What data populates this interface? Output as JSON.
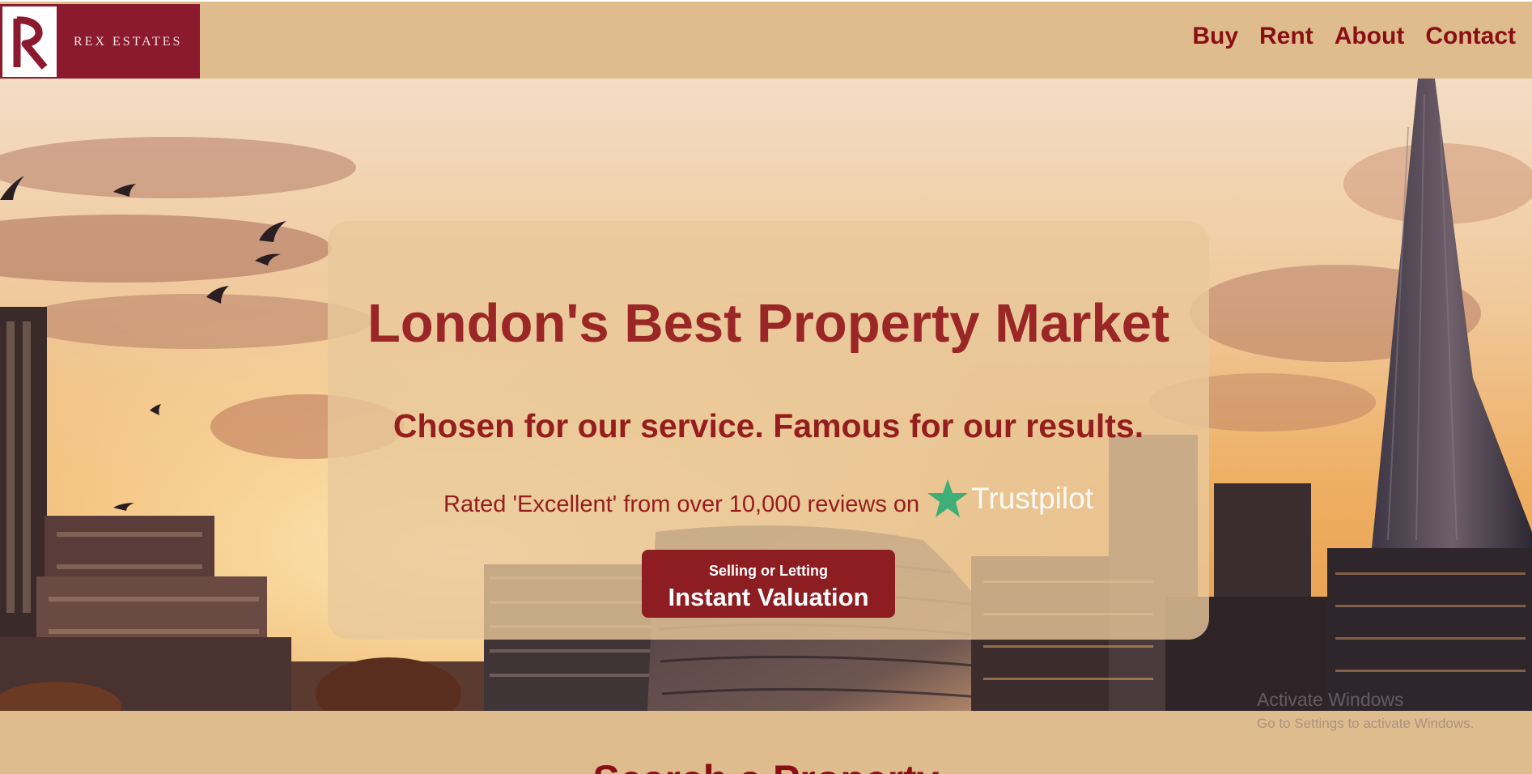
{
  "header": {
    "logo_text": "REX ESTATES",
    "nav": [
      "Buy",
      "Rent",
      "About",
      "Contact"
    ]
  },
  "hero": {
    "title": "London's Best Property Market",
    "subtitle": "Chosen for our service. Famous for our results.",
    "rating_text": "Rated 'Excellent' from over 10,000 reviews on",
    "trustpilot": "Trustpilot",
    "cta_small": "Selling or Letting",
    "cta_big": "Instant Valuation"
  },
  "watermark": {
    "title": "Activate Windows",
    "subtitle": "Go to Settings to activate Windows."
  },
  "next_section": {
    "heading": "Search a Property"
  },
  "colors": {
    "header_bg": "#dfbc8e",
    "logo_bg": "#8c1a2e",
    "accent": "#8a0f14",
    "cta_bg": "#8e1d22",
    "trustpilot_star": "#3fae77"
  },
  "icons": {
    "logo": "r-monogram-icon",
    "trustpilot": "star-icon"
  }
}
